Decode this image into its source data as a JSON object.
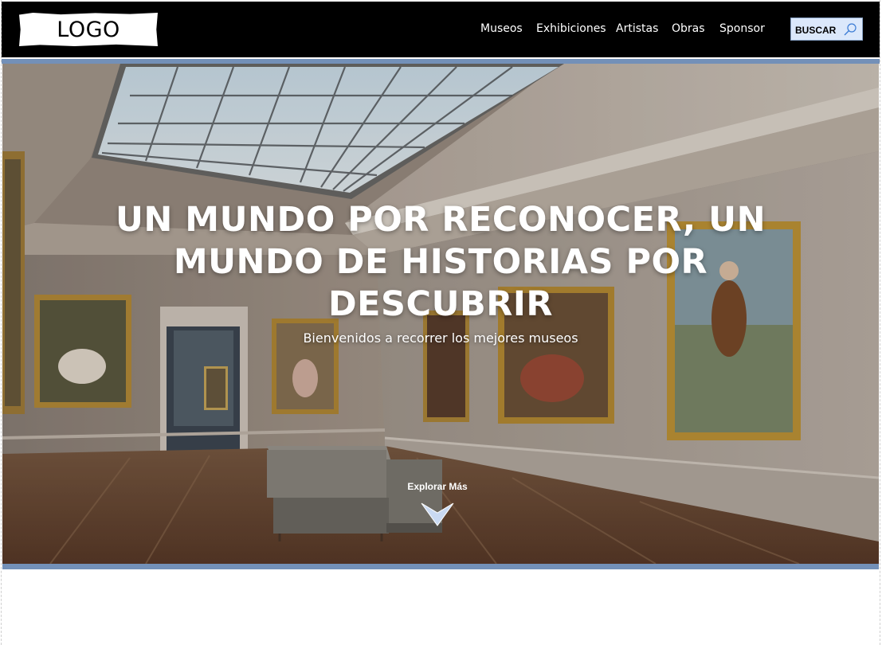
{
  "header": {
    "logo_text": "LOGO",
    "nav": [
      "Museos",
      "Exhibiciones",
      "Artistas",
      "Obras",
      "Sponsor"
    ],
    "search_label": "BUSCAR"
  },
  "hero": {
    "title": "UN MUNDO POR RECONOCER, UN MUNDO DE HISTORIAS POR DESCUBRIR",
    "subtitle": "Bienvenidos a recorrer los mejores museos",
    "explore_label": "Explorar Más"
  },
  "colors": {
    "header_bg": "#000000",
    "accent_bar": "#7390b8",
    "search_bg": "#dbe8fb",
    "arrow": "#c9d9f2"
  },
  "icons": [
    "search-icon",
    "chevron-down-icon"
  ]
}
